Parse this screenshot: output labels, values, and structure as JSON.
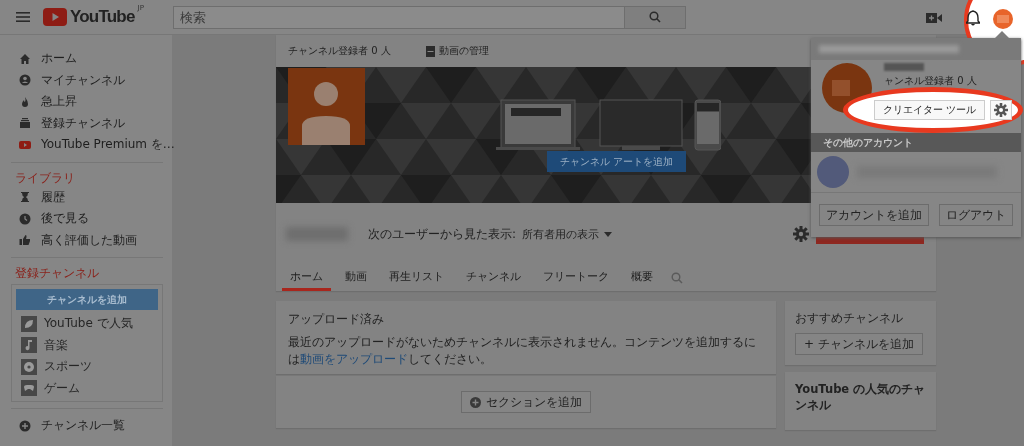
{
  "header": {
    "logo": "YouTube",
    "region": "JP",
    "search_placeholder": "検索"
  },
  "sidebar": {
    "main_items": [
      {
        "label": "ホーム"
      },
      {
        "label": "マイチャンネル"
      },
      {
        "label": "急上昇"
      },
      {
        "label": "登録チャンネル"
      },
      {
        "label": "YouTube Premium を…"
      }
    ],
    "library": {
      "title": "ライブラリ",
      "items": [
        {
          "label": "履歴"
        },
        {
          "label": "後で見る"
        },
        {
          "label": "高く評価した動画"
        }
      ]
    },
    "subscriptions": {
      "title": "登録チャンネル",
      "add_button": "チャンネルを追加",
      "items": [
        {
          "label": "YouTube で人気"
        },
        {
          "label": "音楽"
        },
        {
          "label": "スポーツ"
        },
        {
          "label": "ゲーム"
        }
      ]
    },
    "footer_item": {
      "label": "チャンネル一覧"
    }
  },
  "channel": {
    "subscribers": "チャンネル登録者 0 人",
    "manage_videos": "動画の管理",
    "add_art_button": "チャンネル アートを追加",
    "view_as_label": "次のユーザーから見た表示:",
    "view_as_value": "所有者用の表示",
    "tabs": [
      {
        "label": "ホーム",
        "selected": true
      },
      {
        "label": "動画",
        "selected": false
      },
      {
        "label": "再生リスト",
        "selected": false
      },
      {
        "label": "チャンネル",
        "selected": false
      },
      {
        "label": "フリートーク",
        "selected": false
      },
      {
        "label": "概要",
        "selected": false
      }
    ]
  },
  "uploads": {
    "title": "アップロード済み",
    "text_before": "最近のアップロードがないためチャンネルに表示されません。コンテンツを追加するには",
    "link": "動画をアップロード",
    "text_after": "してください。",
    "add_section_button": "セクションを追加"
  },
  "side_cards": [
    {
      "title": "おすすめチャンネル",
      "button": "+ チャンネルを追加"
    },
    {
      "title": "YouTube の人気のチャンネル"
    }
  ],
  "account_menu": {
    "subscribers": "ャンネル登録者 0 人",
    "creator_tools_button": "クリエイター ツール",
    "other_accounts_title": "その他のアカウント",
    "add_account_button": "アカウントを追加",
    "logout_button": "ログアウト"
  }
}
